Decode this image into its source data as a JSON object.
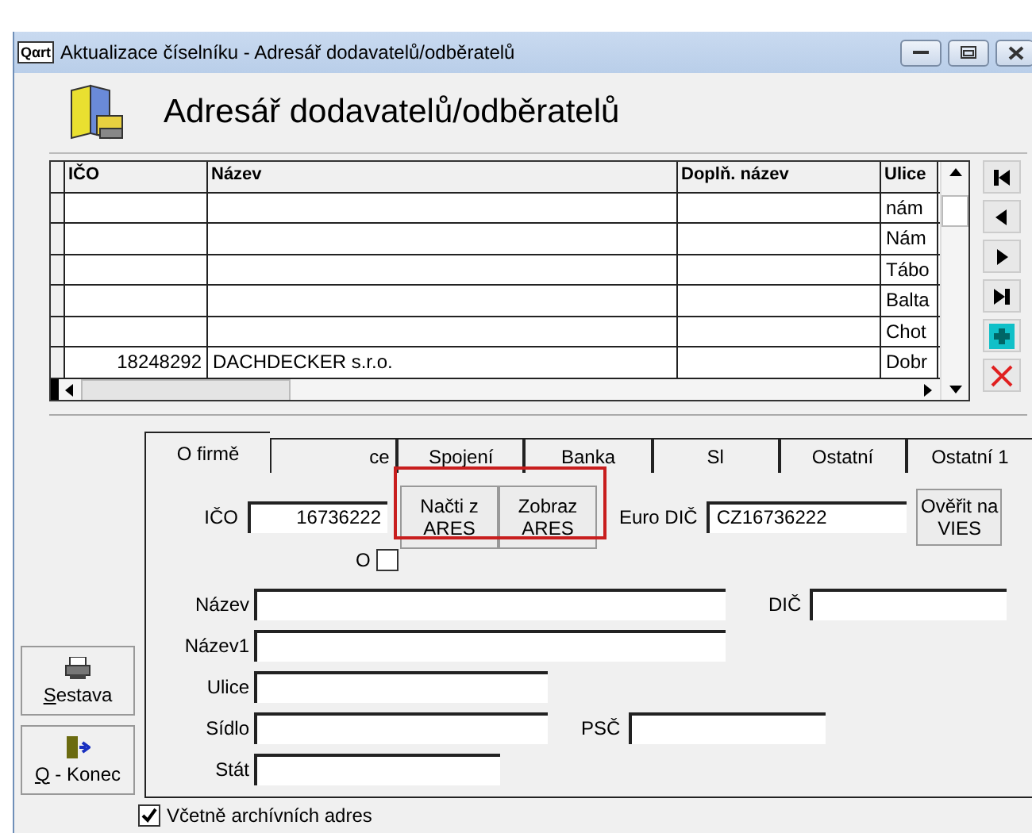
{
  "window": {
    "app_icon": "Qαrt",
    "title": "Aktualizace číselníku - Adresář dodavatelů/odběratelů"
  },
  "heading": "Adresář dodavatelů/odběratelů",
  "table": {
    "columns": [
      "IČO",
      "Název",
      "Doplň. název",
      "Ulice"
    ],
    "rows": [
      {
        "cells": [
          "",
          "",
          "",
          "nám"
        ]
      },
      {
        "cells": [
          "",
          "",
          "",
          "Nám"
        ]
      },
      {
        "cells": [
          "",
          "",
          "",
          "Tábo"
        ]
      },
      {
        "cells": [
          "",
          "",
          "",
          "Balta"
        ]
      },
      {
        "cells": [
          "",
          "",
          "",
          "Chot"
        ]
      },
      {
        "cells": [
          "18248292",
          "DACHDECKER s.r.o.",
          "",
          "Dobr"
        ]
      }
    ]
  },
  "tabs": [
    {
      "label": "O firmě",
      "selected": true
    },
    {
      "label": "ce",
      "selected": false
    },
    {
      "label": "Spojení",
      "selected": false
    },
    {
      "label": "Banka",
      "selected": false
    },
    {
      "label": "Sl",
      "selected": false
    },
    {
      "label": "Ostatní",
      "selected": false
    },
    {
      "label": "Ostatní 1",
      "selected": false
    }
  ],
  "form": {
    "ico_label": "IČO",
    "ico_value": "16736222",
    "load_button": "Načti z ARES",
    "show_button": "Zobraz ARES",
    "euro_dic_label": "Euro DIČ",
    "euro_dic_value": "CZ16736222",
    "verify_button": "Ověřit na VIES",
    "o_label": "O",
    "o_checked": false,
    "fields": [
      {
        "label": "Název"
      },
      {
        "label": "Název1"
      },
      {
        "label": "Ulice"
      },
      {
        "label": "Sídlo"
      },
      {
        "label": "Stát"
      }
    ],
    "dic_label": "DIČ",
    "psc_label": "PSČ"
  },
  "side_buttons": [
    {
      "kind": "print",
      "key": "S",
      "label": "estava"
    },
    {
      "kind": "exit",
      "key": "Q",
      "label": " - Konec"
    }
  ],
  "archive": {
    "label": "Včetně archívních adres",
    "checked": true
  }
}
